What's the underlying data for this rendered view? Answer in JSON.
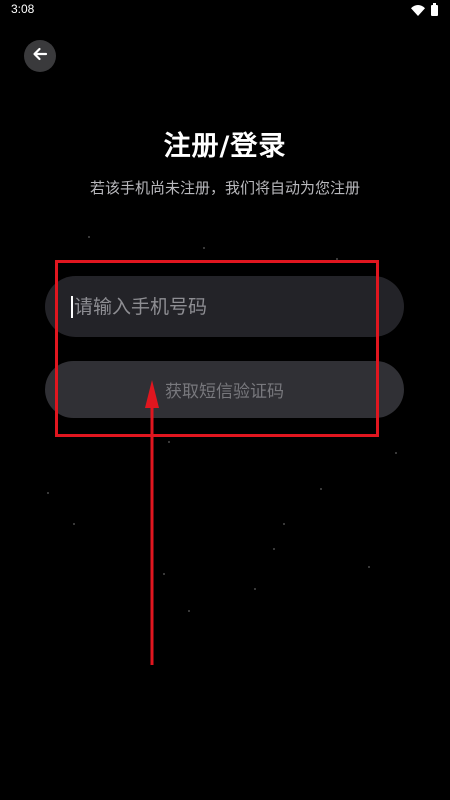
{
  "status_bar": {
    "time": "3:08",
    "icons": [
      "wifi-icon",
      "battery-icon"
    ]
  },
  "header": {
    "back_icon": "arrow-left-icon"
  },
  "login": {
    "title": "注册/登录",
    "subtitle": "若该手机尚未注册，我们将自动为您注册",
    "phone_input": {
      "placeholder": "请输入手机号码",
      "value": ""
    },
    "get_code_button": {
      "label": "获取短信验证码",
      "enabled": false
    }
  },
  "annotation": {
    "color": "#e0161f",
    "type": "highlight-box-with-arrow"
  },
  "colors": {
    "background": "#000000",
    "field_background": "#232328",
    "button_background": "#303035",
    "button_text": "#78787d",
    "subtitle_text": "#b9b9bd"
  }
}
